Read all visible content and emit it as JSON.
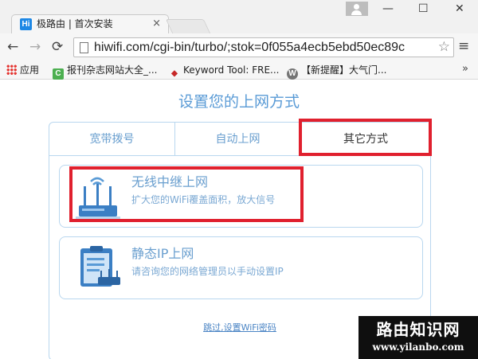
{
  "browser": {
    "tab_title": "极路由 | 首次安装",
    "tab_favicon": "Hi",
    "close_glyph": "×",
    "win_min": "—",
    "win_max": "☐",
    "win_close": "✕",
    "url": "hiwifi.com/cgi-bin/turbo/;stok=0f055a4ecb5ebd50ec89c",
    "back_glyph": "←",
    "forward_glyph": "→",
    "reload_glyph": "⟳",
    "star_glyph": "☆",
    "menu_glyph": "≡",
    "bookmarks_more": "»"
  },
  "bookmarks": [
    {
      "label": "应用",
      "icon": "apps-grid-icon"
    },
    {
      "label": "报刊杂志网站大全_...",
      "icon": "c-icon",
      "icon_text": "C",
      "color": "#4caf50"
    },
    {
      "label": "Keyword Tool: FRE...",
      "icon": "keyword-icon",
      "icon_text": "◆",
      "color": "#c62828"
    },
    {
      "label": "【新提醒】大气门...",
      "icon": "wordpress-icon",
      "icon_text": "W",
      "color": "#757575"
    }
  ],
  "page": {
    "heading": "设置您的上网方式",
    "tabs": [
      {
        "label": "宽带拨号"
      },
      {
        "label": "自动上网"
      },
      {
        "label": "其它方式"
      }
    ],
    "options": [
      {
        "title": "无线中继上网",
        "desc": "扩大您的WiFi覆盖面积，放大信号"
      },
      {
        "title": "静态IP上网",
        "desc": "请咨询您的网络管理员以手动设置IP"
      }
    ],
    "skip_link": "跳过,设置WiFi密码"
  },
  "watermark": {
    "cn": "路由知识网",
    "url": "www.yilanbo.com"
  },
  "colors": {
    "accent_blue": "#5a9bd6",
    "highlight_red": "#e0202e"
  }
}
